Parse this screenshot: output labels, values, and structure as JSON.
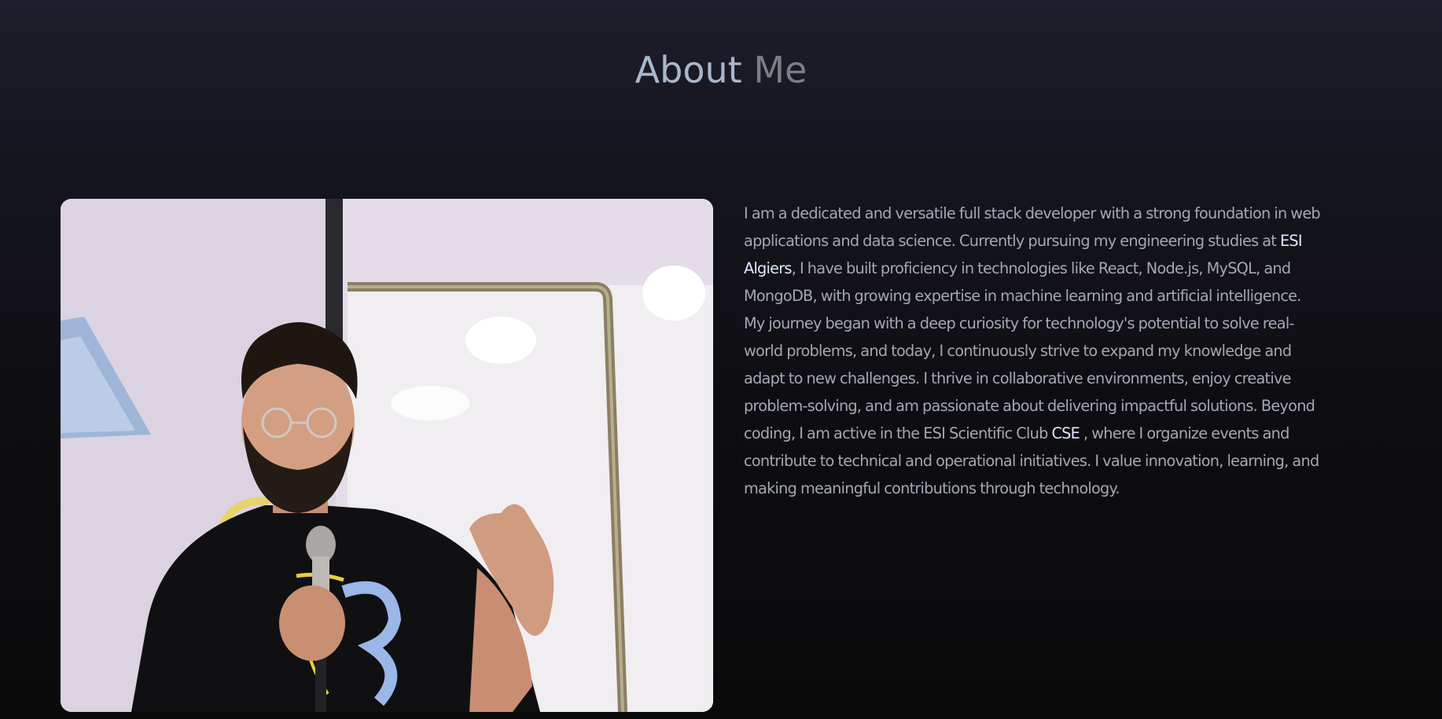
{
  "about": {
    "title_part1": "About",
    "title_part2": "Me",
    "photo_alt": "Speaker holding a microphone in front of a whiteboard",
    "bio": {
      "part1": "I am a dedicated and versatile full stack developer with a strong foundation in web applications and data science. Currently pursuing my engineering studies at ",
      "link1": "ESI Algiers",
      "part2": ", I have built proficiency in technologies like React, Node.js, MySQL, and MongoDB, with growing expertise in machine learning and artificial intelligence. My journey began with a deep curiosity for technology's potential to solve real-world problems, and today, I continuously strive to expand my knowledge and adapt to new challenges. I thrive in collaborative environments, enjoy creative problem-solving, and am passionate about delivering impactful solutions. Beyond coding, I am active in the ESI Scientific Club ",
      "link2": "CSE",
      "part3": " , where I organize events and contribute to technical and operational initiatives. I value innovation, learning, and making meaningful contributions through technology."
    }
  },
  "colors": {
    "background_top": "#1e1e2c",
    "background_bottom": "#0a0a0b",
    "title_primary": "#a8b8cc",
    "title_accent": "#7d7d84",
    "body_text": "#a2a8b4",
    "highlight_text": "#dde8ff"
  }
}
